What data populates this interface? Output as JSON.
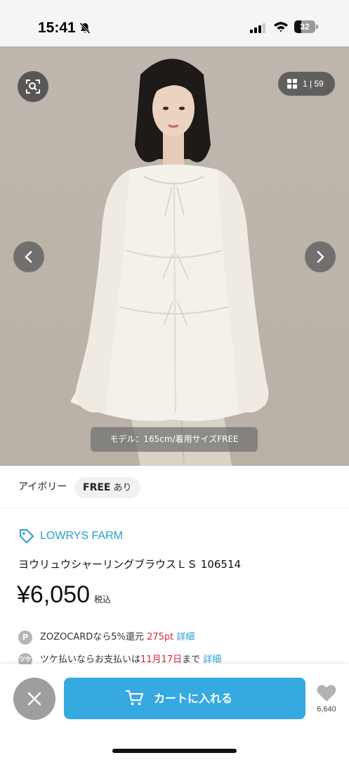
{
  "status_bar": {
    "time": "15:41",
    "battery_level": "32",
    "icons": [
      "bell-slash-icon",
      "signal-icon",
      "wifi-icon",
      "battery-icon"
    ]
  },
  "gallery": {
    "counter": "1 | 59",
    "model_caption": "モデル：165cm/着用サイズFREE",
    "icons": [
      "image-search-icon",
      "grid-icon",
      "chevron-left-icon",
      "chevron-right-icon"
    ]
  },
  "variant": {
    "color": "アイボリー",
    "size": "FREE",
    "stock": "あり"
  },
  "product": {
    "brand": "LOWRYS FARM",
    "name": "ヨウリュウシャーリングブラウスＬＳ 106514",
    "price": "¥6,050",
    "tax_label": "税込",
    "brand_color": "#2a9fd0"
  },
  "zozocard": {
    "badge": "P",
    "text": "ZOZOCARDなら5%還元",
    "points": "275pt",
    "detail_link": "詳細"
  },
  "tsuke": {
    "badge": "ツケ",
    "text_before": "ツケ払いならお支払いは",
    "date": "11月17日",
    "text_after": "まで",
    "detail_link": "詳細"
  },
  "bottom_bar": {
    "cart_label": "カートに入れる",
    "favorite_count": "6,640",
    "cart_color": "#36a9e1",
    "icons": [
      "close-icon",
      "cart-icon",
      "heart-icon"
    ]
  }
}
